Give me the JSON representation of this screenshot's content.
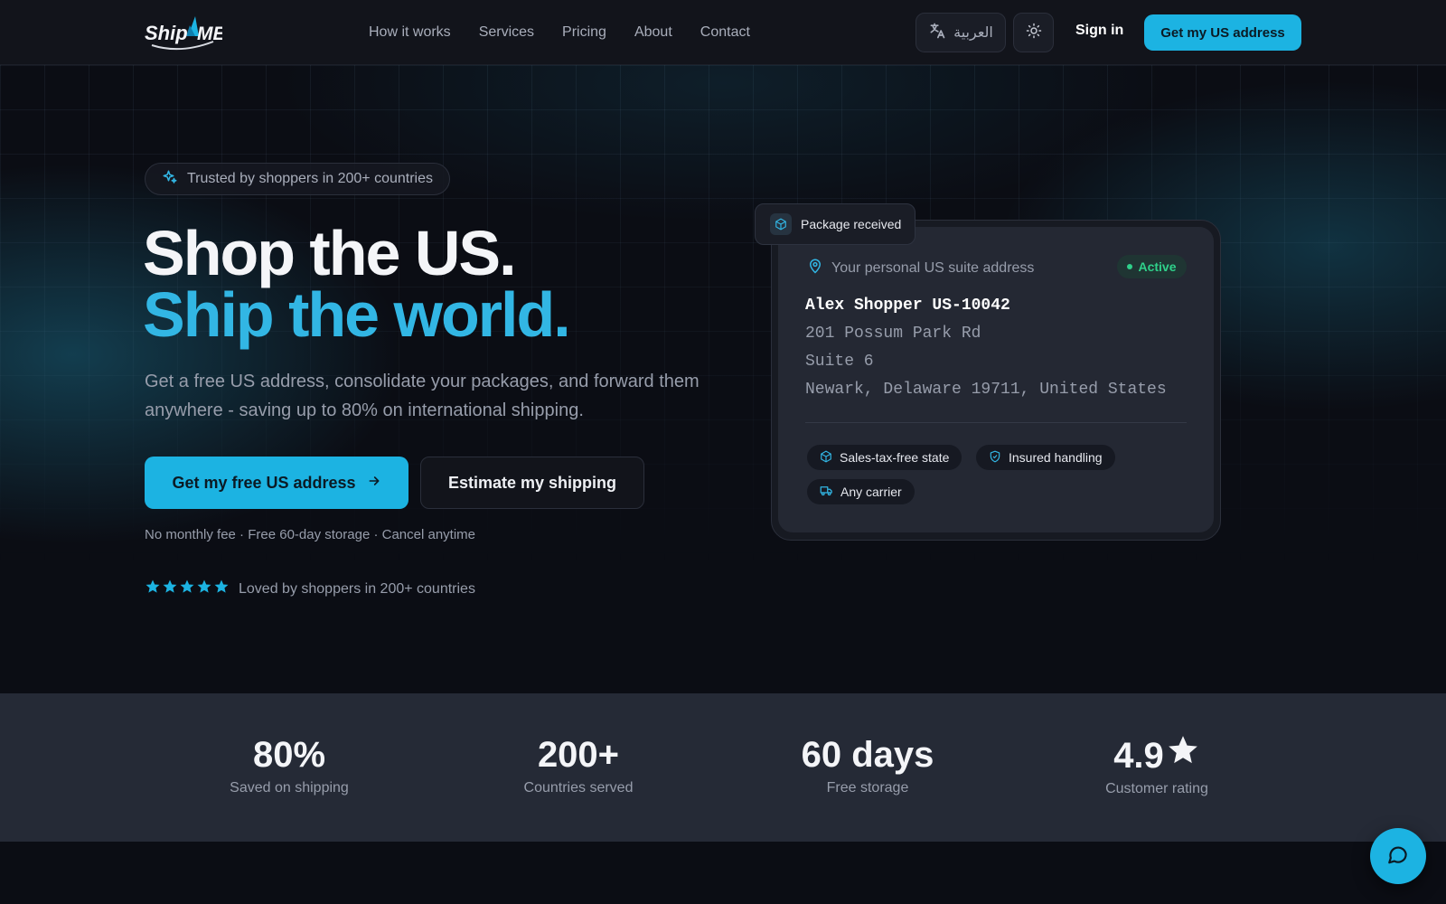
{
  "header": {
    "logo_text": "ShipME",
    "nav": [
      "How it works",
      "Services",
      "Pricing",
      "About",
      "Contact"
    ],
    "language_label": "العربية",
    "theme_icon": "sun-icon",
    "signin_label": "Sign in",
    "cta_label": "Get my US address"
  },
  "hero": {
    "trust_pill": "Trusted by shoppers in 200+ countries",
    "headline_line1": "Shop the US.",
    "headline_line2": "Ship the world.",
    "subtext": "Get a free US address, consolidate your packages, and forward them anywhere - saving up to 80% on international shipping.",
    "primary_button": "Get my free US address",
    "secondary_button": "Estimate my shipping",
    "fineprint": "No monthly fee · Free 60-day storage · Cancel anytime",
    "rating_stars": 5,
    "rating_text": "Loved by shoppers in 200+ countries"
  },
  "card": {
    "floating_chip": "Package received",
    "label": "Your personal US suite address",
    "status": "Active",
    "name_line": "Alex Shopper US-10042",
    "address_lines": [
      "201 Possum Park Rd",
      "Suite 6",
      "Newark, Delaware 19711, United States"
    ],
    "tags": [
      "Sales-tax-free state",
      "Insured handling",
      "Any carrier"
    ]
  },
  "stats": [
    {
      "value": "80%",
      "label": "Saved on shipping"
    },
    {
      "value": "200+",
      "label": "Countries served"
    },
    {
      "value": "60 days",
      "label": "Free storage"
    },
    {
      "value": "4.9",
      "label": "Customer rating"
    }
  ],
  "colors": {
    "accent": "#1cb3e2",
    "headline_accent": "#32b6e4",
    "background": "#0b0d14",
    "success": "#2fd08a"
  }
}
